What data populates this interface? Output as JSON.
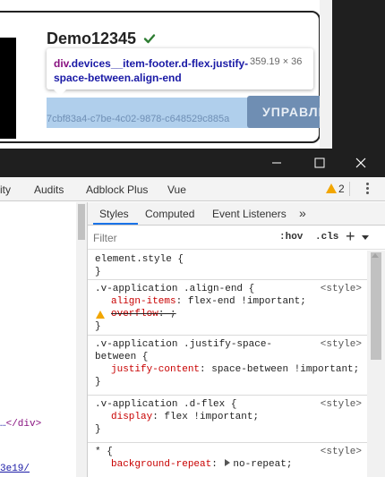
{
  "page": {
    "device_title": "Demo12345",
    "device_id": "7cbf83a4-c7be-4c02-9878-c648529c885a",
    "manage_button": "УПРАВЛЕН",
    "tooltip": {
      "selector_tag": "div",
      "selector_classes": ".devices__item-footer.d-flex.justify-space-between.align-end",
      "size": "359.19 × 36"
    },
    "colors": {
      "check": "#2e7d32",
      "highlight": "#6fa8dc"
    }
  },
  "devtools": {
    "window_controls": [
      "minimize-icon",
      "maximize-icon",
      "close-icon"
    ],
    "tabs": [
      "rity",
      "Audits",
      "Adblock Plus",
      "Vue"
    ],
    "warnings_count": "2",
    "style_tabs": [
      "Styles",
      "Computed",
      "Event Listeners"
    ],
    "more_tabs": "»",
    "filter_placeholder": "Filter",
    "hov": ":hov",
    "cls": ".cls",
    "plus": "+",
    "elements": {
      "line1_ellipsis": "…",
      "line1_tag": "</div>",
      "line2": "3e19/"
    },
    "rules": [
      {
        "selector": "element.style {",
        "source": "",
        "declarations": []
      },
      {
        "selector": ".v-application .align-end {",
        "source": "<style>",
        "declarations": [
          {
            "name": "align-items",
            "value": "flex-end !important;"
          },
          {
            "name": "overflow",
            "value": ";"
          }
        ]
      },
      {
        "selector": ".v-application .justify-space-",
        "selector2": "between {",
        "source": "<style>",
        "declarations": [
          {
            "name": "justify-content",
            "value": "space-between !important;"
          }
        ]
      },
      {
        "selector": ".v-application .d-flex {",
        "source": "<style>",
        "declarations": [
          {
            "name": "display",
            "value": "flex !important;"
          }
        ]
      },
      {
        "selector": "* {",
        "source": "<style>",
        "declarations": [
          {
            "name": "background-repeat",
            "value": "no-repeat;"
          }
        ]
      }
    ],
    "close_brace": "}"
  }
}
